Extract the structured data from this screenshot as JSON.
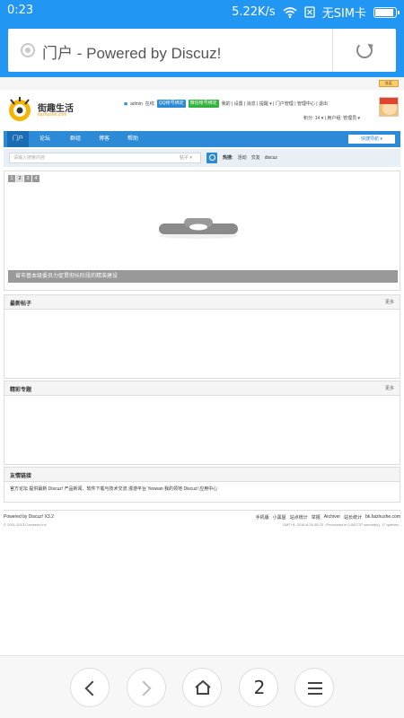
{
  "status_bar": {
    "time": "0:23",
    "net_speed": "5.22K/s",
    "carrier": "无SIM卡",
    "battery_level": 0.85
  },
  "browser": {
    "page_title": "门户 - Powered by Discuz!",
    "tab_count": "2"
  },
  "site": {
    "top_button": "社区",
    "logo_title": "街趣生活",
    "logo_subtitle": "faizhushe.com",
    "user_name": "admin",
    "user_status": "在线",
    "qq_bind": "QQ帐号绑定",
    "wx_bind": "微信帐号绑定",
    "user_links": "我的 | 设置 | 消息 | 提醒 ▾ | 门户管理 | 管理中心 | 退出",
    "user_stats": "积分: 14 ▾ | 用户组: 管理员 ▾",
    "nav": [
      "门户",
      "论坛",
      "群组",
      "博客",
      "帮助"
    ],
    "quick_nav": "快捷导航 ▾",
    "search_placeholder": "请输入搜索内容",
    "search_type": "帖子 ▾",
    "hot_label": "热搜:",
    "hot_terms": [
      "活动",
      "交友",
      "discuz"
    ],
    "slide_tabs": [
      "1",
      "2",
      "3",
      "4"
    ],
    "slide_caption": "省市基本级委员力促贯彻长阶段的精准建设",
    "panels": {
      "latest_title": "最新帖子",
      "latest_more": "更多",
      "featured_title": "精彩专题",
      "featured_more": "更多",
      "links_title": "友情链接",
      "links_body": "官方论坛  提供最新 Discuz! 产品新闻、软件下载与技术交流  漫游平台  Yeswan  我的领地  Discuz! 应用中心"
    },
    "footer": {
      "powered": "Powered by Discuz! X3.2",
      "copyright": "© 2001-2013 Comsenz Inc.",
      "links": [
        "手机版",
        "小黑屋",
        "站点统计",
        "举报",
        "Archiver",
        "站长统计",
        "bk.faizhushe.com"
      ],
      "time_info": "GMT+8, 2016-8-26 00:23 , Processed in 0.062737 second(s), 17 queries ."
    }
  }
}
